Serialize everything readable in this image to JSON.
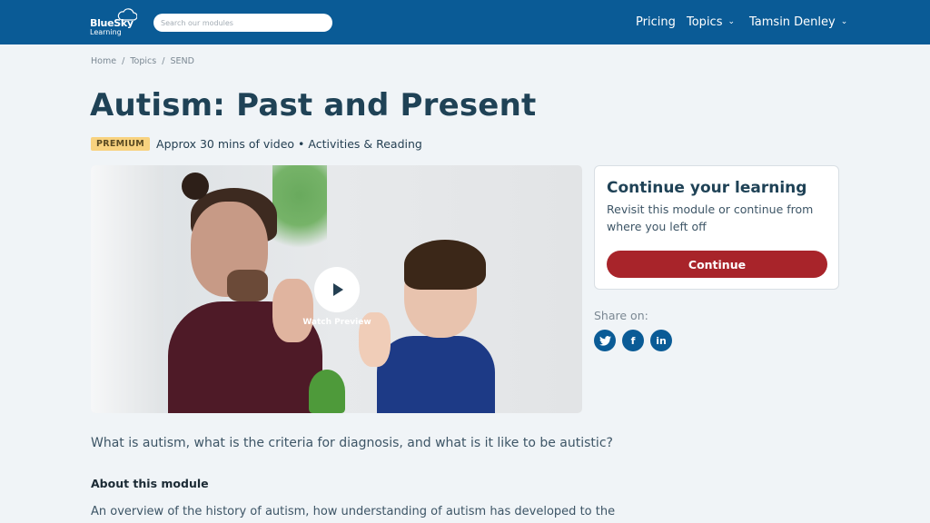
{
  "header": {
    "logo": {
      "line1": "BlueSky",
      "line2": "Learning"
    },
    "search": {
      "placeholder": "Search our modules",
      "value": ""
    },
    "nav": {
      "pricing": "Pricing",
      "topics": "Topics",
      "user": "Tamsin Denley"
    }
  },
  "breadcrumb": [
    "Home",
    "Topics",
    "SEND"
  ],
  "breadcrumb_separator": "/",
  "page": {
    "title": "Autism: Past and Present",
    "badge": "PREMIUM",
    "meta": "Approx 30 mins of video • Activities & Reading"
  },
  "video": {
    "label": "Watch Preview"
  },
  "continue_card": {
    "title": "Continue your learning",
    "text": "Revisit this module or continue from where you left off",
    "button": "Continue"
  },
  "share": {
    "label": "Share on:",
    "networks": [
      {
        "name": "twitter",
        "glyph": "🐦"
      },
      {
        "name": "facebook",
        "glyph": "f"
      },
      {
        "name": "linkedin",
        "glyph": "in"
      }
    ]
  },
  "content": {
    "question": "What is autism, what is the criteria for diagnosis, and what is it like to be autistic?",
    "about_heading": "About this module",
    "about_text": "An overview of the history of autism, how understanding of autism has developed to the"
  },
  "colors": {
    "brand": "#0a5b96",
    "accent_button": "#a8242a",
    "badge": "#f8d27f",
    "title": "#1f4256",
    "background": "#f0f4f7"
  }
}
